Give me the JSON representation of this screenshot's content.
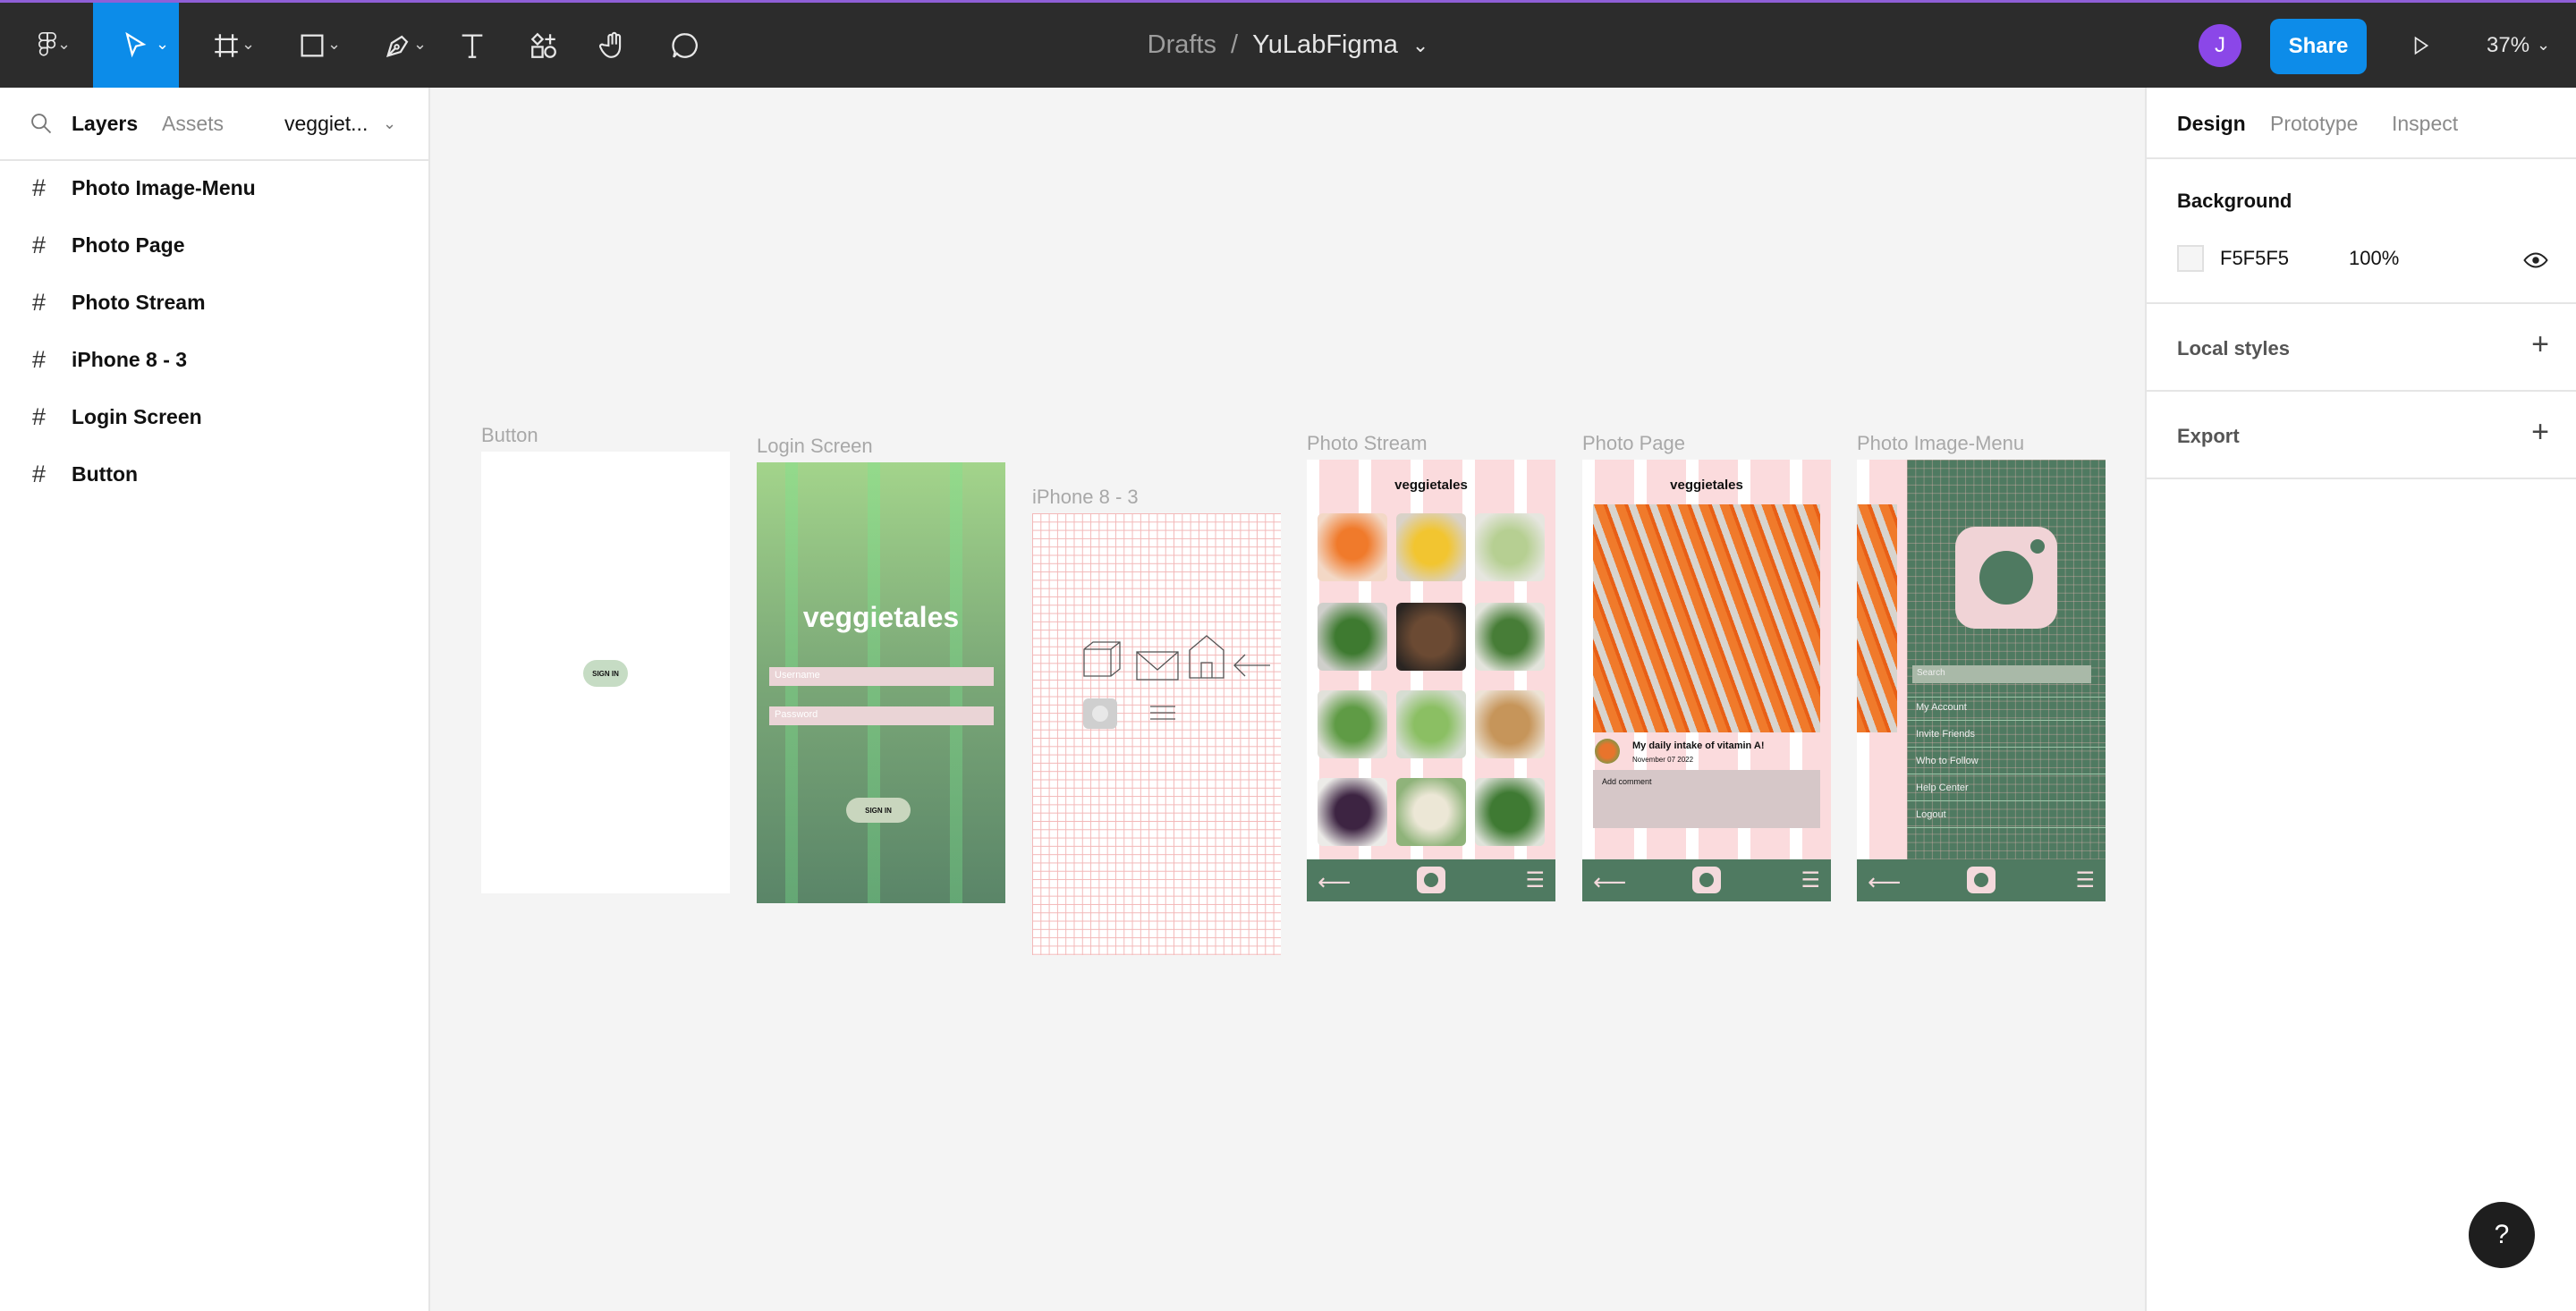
{
  "toolbar": {
    "breadcrumb_parent": "Drafts",
    "breadcrumb_separator": "/",
    "file_name": "YuLabFigma",
    "avatar_initial": "J",
    "share_label": "Share",
    "zoom": "37%",
    "accent_color": "#0c8ce9"
  },
  "left_panel": {
    "tabs": [
      "Layers",
      "Assets"
    ],
    "page_name": "veggiet...",
    "layers": [
      "Photo Image-Menu",
      "Photo Page",
      "Photo Stream",
      "iPhone 8 - 3",
      "Login Screen",
      "Button"
    ]
  },
  "right_panel": {
    "tabs": [
      "Design",
      "Prototype",
      "Inspect"
    ],
    "background_title": "Background",
    "background_hex": "F5F5F5",
    "background_opacity": "100%",
    "local_styles": "Local styles",
    "export": "Export"
  },
  "canvas": {
    "frames": {
      "button": {
        "label": "Button",
        "sign_in": "SIGN IN"
      },
      "login": {
        "label": "Login Screen",
        "title": "veggietales",
        "username": "Username",
        "password": "Password",
        "sign_in": "SIGN IN"
      },
      "iphone": {
        "label": "iPhone 8 - 3"
      },
      "stream": {
        "label": "Photo Stream",
        "title": "veggietales"
      },
      "page": {
        "label": "Photo Page",
        "title": "veggietales",
        "post_title": "My daily intake of vitamin A!",
        "post_date": "November 07 2022",
        "comment_placeholder": "Add comment"
      },
      "menu": {
        "label": "Photo Image-Menu",
        "search": "Search",
        "items": [
          "My Account",
          "Invite Friends",
          "Who to Follow",
          "Help Center",
          "Logout"
        ]
      }
    }
  },
  "help_label": "?"
}
